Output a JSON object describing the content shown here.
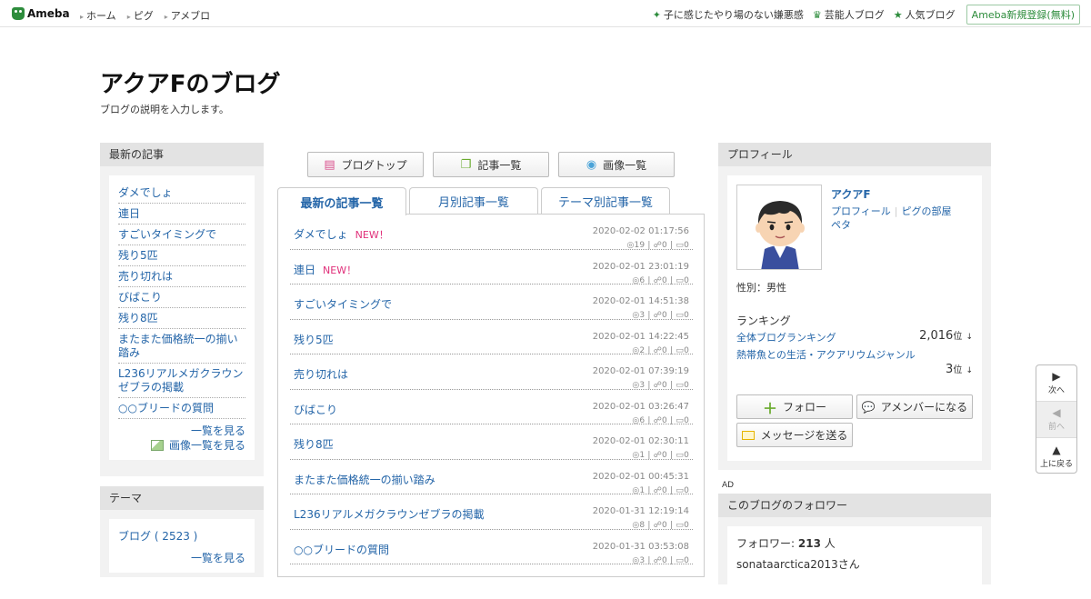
{
  "topbar": {
    "logo": "Ameba",
    "nav": [
      "ホーム",
      "ピグ",
      "アメブロ"
    ],
    "right": [
      {
        "icon": "sparkle-icon",
        "glyph": "✦",
        "label": "子に感じたやり場のない嫌悪感"
      },
      {
        "icon": "crown-icon",
        "glyph": "♛",
        "label": "芸能人ブログ"
      },
      {
        "icon": "star-icon",
        "glyph": "★",
        "label": "人気ブログ"
      }
    ],
    "register": "Ameba新規登録(無料)"
  },
  "blog": {
    "title": "アクアFのブログ",
    "description": "ブログの説明を入力します。"
  },
  "left": {
    "recent_header": "最新の記事",
    "recent": [
      "ダメでしょ",
      "連日",
      "すごいタイミングで",
      "残り5匹",
      "売り切れは",
      "びばこり",
      "残り8匹",
      "またまた価格統一の揃い踏み",
      "L236リアルメガクラウンゼブラの掲載",
      "○○ブリードの質問"
    ],
    "more_list": "一覧を見る",
    "more_images": "画像一覧を見る",
    "theme_header": "テーマ",
    "themes": [
      "ブログ ( 2523 )"
    ],
    "theme_more": "一覧を見る"
  },
  "center": {
    "buttons": [
      {
        "icon": "document-icon",
        "glyph": "▤",
        "color": "#d94f8c",
        "label": "ブログトップ"
      },
      {
        "icon": "copy-icon",
        "glyph": "❐",
        "color": "#6aab2e",
        "label": "記事一覧"
      },
      {
        "icon": "camera-icon",
        "glyph": "◉",
        "color": "#4aa3d8",
        "label": "画像一覧"
      }
    ],
    "tabs": [
      "最新の記事一覧",
      "月別記事一覧",
      "テーマ別記事一覧"
    ],
    "new_label": "NEW！",
    "entries": [
      {
        "title": "ダメでしょ",
        "new": true,
        "date": "2020-02-02 01:17:56",
        "views": "19",
        "likes": "0",
        "comments": "0"
      },
      {
        "title": "連日",
        "new": true,
        "date": "2020-02-01 23:01:19",
        "views": "6",
        "likes": "0",
        "comments": "0"
      },
      {
        "title": "すごいタイミングで",
        "new": false,
        "date": "2020-02-01 14:51:38",
        "views": "3",
        "likes": "0",
        "comments": "0"
      },
      {
        "title": "残り5匹",
        "new": false,
        "date": "2020-02-01 14:22:45",
        "views": "2",
        "likes": "0",
        "comments": "0"
      },
      {
        "title": "売り切れは",
        "new": false,
        "date": "2020-02-01 07:39:19",
        "views": "3",
        "likes": "0",
        "comments": "0"
      },
      {
        "title": "びばこり",
        "new": false,
        "date": "2020-02-01 03:26:47",
        "views": "6",
        "likes": "0",
        "comments": "0"
      },
      {
        "title": "残り8匹",
        "new": false,
        "date": "2020-02-01 02:30:11",
        "views": "1",
        "likes": "0",
        "comments": "0"
      },
      {
        "title": "またまた価格統一の揃い踏み",
        "new": false,
        "date": "2020-02-01 00:45:31",
        "views": "1",
        "likes": "0",
        "comments": "0"
      },
      {
        "title": "L236リアルメガクラウンゼブラの掲載",
        "new": false,
        "date": "2020-01-31 12:19:14",
        "views": "8",
        "likes": "0",
        "comments": "0"
      },
      {
        "title": "○○ブリードの質問",
        "new": false,
        "date": "2020-01-31 03:53:08",
        "views": "3",
        "likes": "0",
        "comments": "0"
      }
    ]
  },
  "profile": {
    "header": "プロフィール",
    "name": "アクアF",
    "link_profile": "プロフィール",
    "link_room": "ピグの部屋",
    "link_peta": "ペタ",
    "gender": "性別：男性",
    "ranking_label": "ランキング",
    "rankings": [
      {
        "label": "全体ブログランキング",
        "value": "2,016",
        "unit": "位",
        "arrow": "↓"
      },
      {
        "label": "熱帯魚との生活・アクアリウムジャンル",
        "value": "3",
        "unit": "位",
        "arrow": "↓"
      }
    ],
    "follow": "フォロー",
    "amember": "アメンバーになる",
    "message": "メッセージを送る"
  },
  "ad_label": "AD",
  "followers": {
    "header": "このブログのフォロワー",
    "label": "フォロワー:",
    "count": "213",
    "unit": "人",
    "first": "sonataarctica2013さん"
  },
  "sidenav": {
    "next": "次へ",
    "prev": "前へ",
    "top": "上に戻る"
  }
}
